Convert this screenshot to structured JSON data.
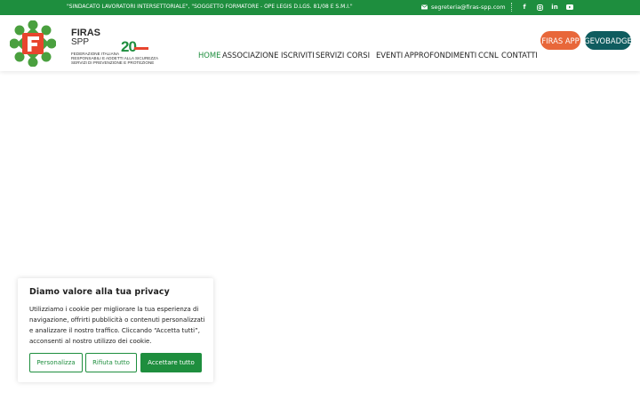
{
  "topbar": {
    "tagline": "\"SINDACATO LAVORATORI INTERSETTORIALE\", \"SOGGETTO FORMATORE - OPE LEGIS D.LGS. 81/08 E S.M.I.\"",
    "email": "segreteria@firas-spp.com",
    "social": [
      "facebook-icon",
      "instagram-icon",
      "linkedin-icon",
      "youtube-icon"
    ]
  },
  "logo": {
    "name": "FIRAS",
    "sub": "SPP",
    "line1": "FEDERAZIONE ITALIANA",
    "line2": "RESPONSABILI E ADDETTI ALLA SICUREZZA",
    "line3": "SERVIZI DI PREVENZIONE E PROTEZIONE",
    "anniversary": "20"
  },
  "nav": {
    "items": [
      "HOME",
      "ASSOCIAZIONE",
      "ISCRIVITI",
      "SERVIZI",
      "CORSI",
      "EVENTI",
      "APPROFONDIMENTI",
      "CCNL",
      "CONTATTI"
    ],
    "app_button": "FIRAS APP",
    "badge_button": "GEVOBADGE"
  },
  "cookie": {
    "title": "Diamo valore alla tua privacy",
    "text": "Utilizziamo i cookie per migliorare la tua esperienza di navigazione, offrirti pubblicità o contenuti personalizzati e analizzare il nostro traffico. Cliccando “Accetta tutti”, acconsenti al nostro utilizzo dei cookie.",
    "customize": "Personalizza",
    "reject": "Rifiuta tutto",
    "accept": "Accettare tutto"
  },
  "colors": {
    "brand_green": "#1e8e3e",
    "orange": "#e8673a",
    "teal": "#0f5c5f"
  }
}
